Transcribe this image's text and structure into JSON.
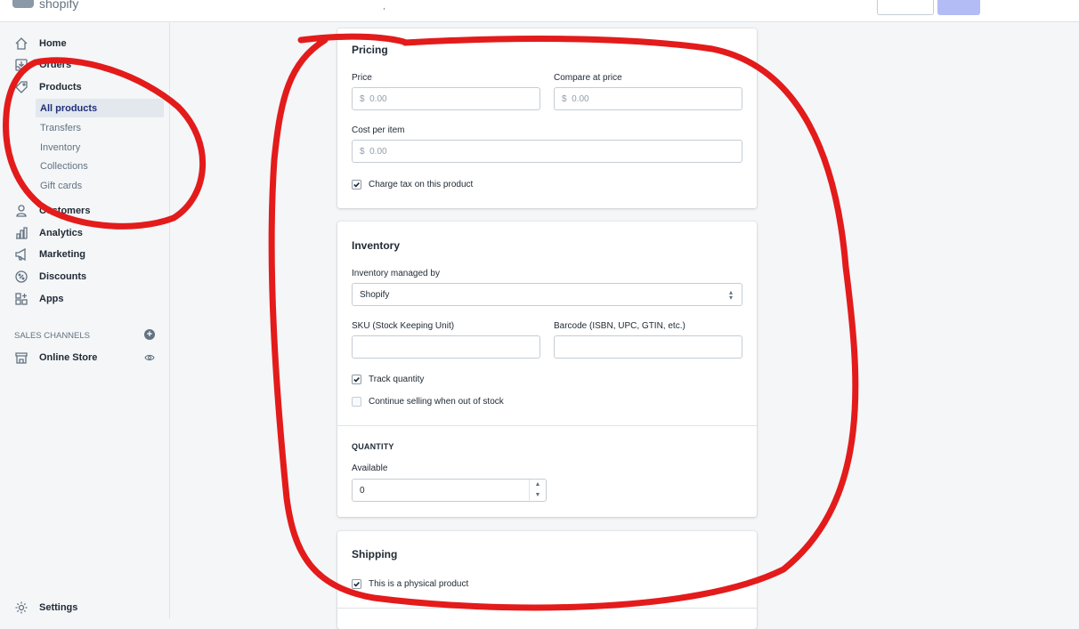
{
  "app": {
    "logo_text": "shopify"
  },
  "sidebar": {
    "home": "Home",
    "orders": "Orders",
    "products": "Products",
    "product_sub": [
      "All products",
      "Transfers",
      "Inventory",
      "Collections",
      "Gift cards"
    ],
    "customers": "Customers",
    "analytics": "Analytics",
    "marketing": "Marketing",
    "discounts": "Discounts",
    "apps": "Apps",
    "sales_channels_label": "SALES CHANNELS",
    "online_store": "Online Store",
    "settings": "Settings"
  },
  "pricing": {
    "title": "Pricing",
    "price_label": "Price",
    "price_prefix": "$",
    "price_placeholder": "0.00",
    "compare_label": "Compare at price",
    "compare_prefix": "$",
    "compare_placeholder": "0.00",
    "cost_label": "Cost per item",
    "cost_prefix": "$",
    "cost_placeholder": "0.00",
    "charge_tax_label": "Charge tax on this product",
    "charge_tax_checked": true
  },
  "inventory": {
    "title": "Inventory",
    "managed_by_label": "Inventory managed by",
    "managed_by_value": "Shopify",
    "sku_label": "SKU (Stock Keeping Unit)",
    "sku_value": "",
    "barcode_label": "Barcode (ISBN, UPC, GTIN, etc.)",
    "barcode_value": "",
    "track_quantity_label": "Track quantity",
    "track_quantity_checked": true,
    "continue_selling_label": "Continue selling when out of stock",
    "continue_selling_checked": false,
    "quantity_heading": "QUANTITY",
    "available_label": "Available",
    "available_value": "0"
  },
  "shipping": {
    "title": "Shipping",
    "physical_label": "This is a physical product",
    "physical_checked": true
  },
  "annotation": {
    "color": "#e31b1b"
  }
}
